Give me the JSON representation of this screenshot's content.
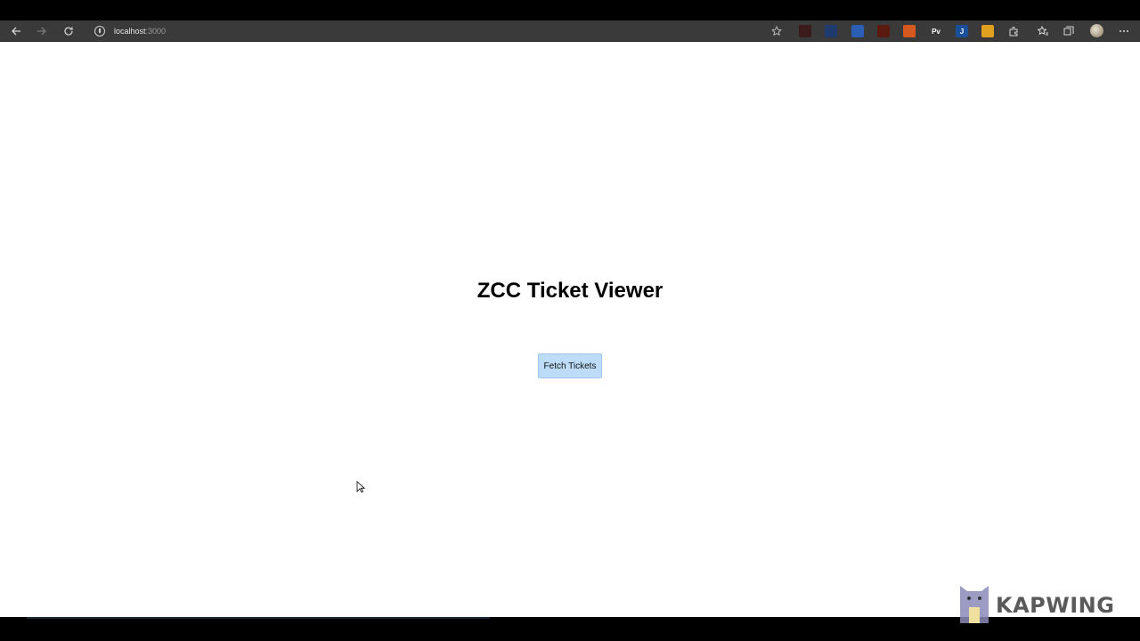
{
  "browser": {
    "url_host": "localhost",
    "url_port": ":3000",
    "extensions": [
      {
        "name": "ext-1-icon",
        "label": "",
        "color": "#3a1a1a"
      },
      {
        "name": "ext-2-icon",
        "label": "",
        "color": "#1e3a6e"
      },
      {
        "name": "ext-3-icon",
        "label": "",
        "color": "#2b5fb3"
      },
      {
        "name": "ext-4-icon",
        "label": "",
        "color": "#5a1a10"
      },
      {
        "name": "ext-5-icon",
        "label": "",
        "color": "#d65a20"
      },
      {
        "name": "ext-6-icon",
        "label": "Pv",
        "color": "#3a3a3a"
      },
      {
        "name": "ext-7-icon",
        "label": "J",
        "color": "#1a4f9a"
      },
      {
        "name": "ext-8-icon",
        "label": "",
        "color": "#e0a020"
      }
    ]
  },
  "page": {
    "title": "ZCC Ticket Viewer",
    "fetch_button_label": "Fetch Tickets"
  },
  "watermark": {
    "text": "KAPWING"
  },
  "colors": {
    "button_bg": "#bcdcf7",
    "toolbar_bg": "#3a3a3a"
  }
}
